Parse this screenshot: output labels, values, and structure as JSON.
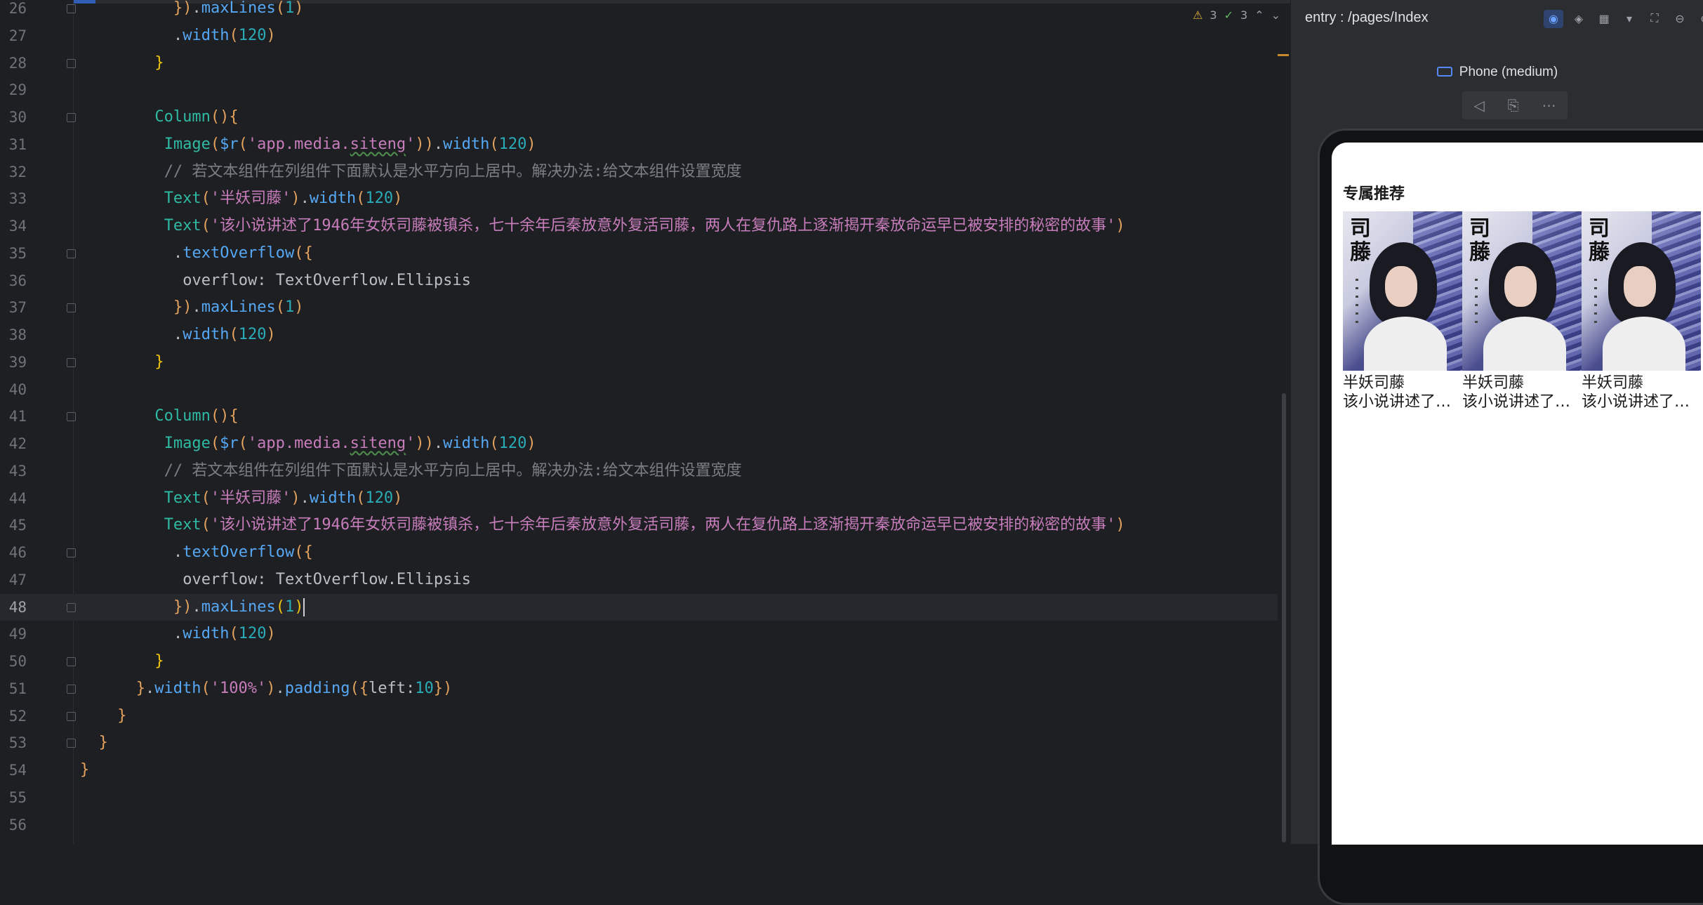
{
  "editor": {
    "inspections": {
      "warnings": "3",
      "weak_warnings": "3"
    },
    "current_line": "48",
    "lines": [
      {
        "n": "26",
        "segs": [
          [
            "k-br2",
            "})"
          ],
          [
            "k-prop",
            "."
          ],
          [
            "k-fn",
            "maxLines"
          ],
          [
            "k-br2",
            "("
          ],
          [
            "k-num",
            "1"
          ],
          [
            "k-br2",
            ")"
          ]
        ]
      },
      {
        "n": "27",
        "segs": [
          [
            "k-prop",
            "."
          ],
          [
            "k-fn",
            "width"
          ],
          [
            "k-br2",
            "("
          ],
          [
            "k-num",
            "120"
          ],
          [
            "k-br2",
            ")"
          ]
        ]
      },
      {
        "n": "28",
        "segs": [
          [
            "k-br",
            "}"
          ]
        ]
      },
      {
        "n": "29",
        "segs": []
      },
      {
        "n": "30",
        "segs": [
          [
            "k-cmp",
            "Column"
          ],
          [
            "k-br2",
            "(){"
          ]
        ]
      },
      {
        "n": "31",
        "segs": [
          [
            "k-cmp",
            "Image"
          ],
          [
            "k-br2",
            "("
          ],
          [
            "k-fn",
            "$r"
          ],
          [
            "k-br2",
            "("
          ],
          [
            "k-str",
            "'app.media."
          ],
          [
            "k-str k-err",
            "siteng"
          ],
          [
            "k-str",
            "'"
          ],
          [
            "k-br2",
            "))"
          ],
          [
            "k-prop",
            "."
          ],
          [
            "k-fn",
            "width"
          ],
          [
            "k-br2",
            "("
          ],
          [
            "k-num",
            "120"
          ],
          [
            "k-br2",
            ")"
          ]
        ]
      },
      {
        "n": "32",
        "segs": [
          [
            "k-cm",
            "// 若文本组件在列组件下面默认是水平方向上居中。解决办法:给文本组件设置宽度"
          ]
        ]
      },
      {
        "n": "33",
        "segs": [
          [
            "k-cmp",
            "Text"
          ],
          [
            "k-br2",
            "("
          ],
          [
            "k-str",
            "'半妖司藤'"
          ],
          [
            "k-br2",
            ")"
          ],
          [
            "k-prop",
            "."
          ],
          [
            "k-fn",
            "width"
          ],
          [
            "k-br2",
            "("
          ],
          [
            "k-num",
            "120"
          ],
          [
            "k-br2",
            ")"
          ]
        ]
      },
      {
        "n": "34",
        "segs": [
          [
            "k-cmp",
            "Text"
          ],
          [
            "k-br2",
            "("
          ],
          [
            "k-str",
            "'该小说讲述了1946年女妖司藤被镇杀，七十余年后秦放意外复活司藤，两人在复仇路上逐渐揭开秦放命运早已被安排的秘密的故事'"
          ],
          [
            "k-br2",
            ")"
          ]
        ]
      },
      {
        "n": "35",
        "segs": [
          [
            "k-prop",
            "."
          ],
          [
            "k-fn",
            "textOverflow"
          ],
          [
            "k-br2",
            "({"
          ]
        ]
      },
      {
        "n": "36",
        "segs": [
          [
            "k-prop",
            "overflow: TextOverflow.Ellipsis"
          ]
        ]
      },
      {
        "n": "37",
        "segs": [
          [
            "k-br2",
            "})"
          ],
          [
            "k-prop",
            "."
          ],
          [
            "k-fn",
            "maxLines"
          ],
          [
            "k-br2",
            "("
          ],
          [
            "k-num",
            "1"
          ],
          [
            "k-br2",
            ")"
          ]
        ]
      },
      {
        "n": "38",
        "segs": [
          [
            "k-prop",
            "."
          ],
          [
            "k-fn",
            "width"
          ],
          [
            "k-br2",
            "("
          ],
          [
            "k-num",
            "120"
          ],
          [
            "k-br2",
            ")"
          ]
        ]
      },
      {
        "n": "39",
        "segs": [
          [
            "k-br",
            "}"
          ]
        ]
      },
      {
        "n": "40",
        "segs": []
      },
      {
        "n": "41",
        "segs": [
          [
            "k-cmp",
            "Column"
          ],
          [
            "k-br2",
            "(){"
          ]
        ]
      },
      {
        "n": "42",
        "segs": [
          [
            "k-cmp",
            "Image"
          ],
          [
            "k-br2",
            "("
          ],
          [
            "k-fn",
            "$r"
          ],
          [
            "k-br2",
            "("
          ],
          [
            "k-str",
            "'app.media."
          ],
          [
            "k-str k-err",
            "siteng"
          ],
          [
            "k-str",
            "'"
          ],
          [
            "k-br2",
            "))"
          ],
          [
            "k-prop",
            "."
          ],
          [
            "k-fn",
            "width"
          ],
          [
            "k-br2",
            "("
          ],
          [
            "k-num",
            "120"
          ],
          [
            "k-br2",
            ")"
          ]
        ]
      },
      {
        "n": "43",
        "segs": [
          [
            "k-cm",
            "// 若文本组件在列组件下面默认是水平方向上居中。解决办法:给文本组件设置宽度"
          ]
        ]
      },
      {
        "n": "44",
        "segs": [
          [
            "k-cmp",
            "Text"
          ],
          [
            "k-br2",
            "("
          ],
          [
            "k-str",
            "'半妖司藤'"
          ],
          [
            "k-br2",
            ")"
          ],
          [
            "k-prop",
            "."
          ],
          [
            "k-fn",
            "width"
          ],
          [
            "k-br2",
            "("
          ],
          [
            "k-num",
            "120"
          ],
          [
            "k-br2",
            ")"
          ]
        ]
      },
      {
        "n": "45",
        "segs": [
          [
            "k-cmp",
            "Text"
          ],
          [
            "k-br2",
            "("
          ],
          [
            "k-str",
            "'该小说讲述了1946年女妖司藤被镇杀，七十余年后秦放意外复活司藤，两人在复仇路上逐渐揭开秦放命运早已被安排的秘密的故事'"
          ],
          [
            "k-br2",
            ")"
          ]
        ]
      },
      {
        "n": "46",
        "segs": [
          [
            "k-prop",
            "."
          ],
          [
            "k-fn",
            "textOverflow"
          ],
          [
            "k-br2",
            "({"
          ]
        ]
      },
      {
        "n": "47",
        "segs": [
          [
            "k-prop",
            "overflow: TextOverflow.Ellipsis"
          ]
        ]
      },
      {
        "n": "48",
        "segs": [
          [
            "k-br2",
            "})"
          ],
          [
            "k-prop",
            "."
          ],
          [
            "k-fn",
            "maxLines"
          ],
          [
            "k-br",
            "("
          ],
          [
            "k-num",
            "1"
          ],
          [
            "k-br",
            ")"
          ]
        ]
      },
      {
        "n": "49",
        "segs": [
          [
            "k-prop",
            "."
          ],
          [
            "k-fn",
            "width"
          ],
          [
            "k-br2",
            "("
          ],
          [
            "k-num",
            "120"
          ],
          [
            "k-br2",
            ")"
          ]
        ]
      },
      {
        "n": "50",
        "segs": [
          [
            "k-br",
            "}"
          ]
        ]
      },
      {
        "n": "51",
        "segs": [
          [
            "k-br2",
            "}"
          ],
          [
            "k-prop",
            "."
          ],
          [
            "k-fn",
            "width"
          ],
          [
            "k-br2",
            "("
          ],
          [
            "k-str",
            "'100%'"
          ],
          [
            "k-br2",
            ")"
          ],
          [
            "k-prop",
            "."
          ],
          [
            "k-fn",
            "padding"
          ],
          [
            "k-br2",
            "({"
          ],
          [
            "k-prop",
            "left:"
          ],
          [
            "k-num",
            "10"
          ],
          [
            "k-br2",
            "})"
          ]
        ]
      },
      {
        "n": "52",
        "segs": [
          [
            "k-br2",
            "}"
          ]
        ]
      },
      {
        "n": "53",
        "segs": [
          [
            "k-br2",
            "}"
          ]
        ]
      },
      {
        "n": "54",
        "segs": [
          [
            "k-br2",
            "}"
          ]
        ]
      },
      {
        "n": "55",
        "segs": []
      },
      {
        "n": "56",
        "segs": []
      }
    ],
    "indent": [
      10,
      10,
      8,
      0,
      8,
      9,
      9,
      9,
      9,
      10,
      11,
      10,
      10,
      8,
      0,
      8,
      9,
      9,
      9,
      9,
      10,
      11,
      10,
      10,
      8,
      6,
      4,
      2,
      0,
      0,
      0
    ]
  },
  "preview": {
    "path": "entry : /pages/Index",
    "device": "Phone (medium)",
    "app": {
      "title": "专属推荐",
      "cards": [
        {
          "title": "半妖司藤",
          "desc": "该小说讲述了…",
          "cover_glyph": "司藤"
        },
        {
          "title": "半妖司藤",
          "desc": "该小说讲述了…",
          "cover_glyph": "司藤"
        },
        {
          "title": "半妖司藤",
          "desc": "该小说讲述了…",
          "cover_glyph": "司藤"
        }
      ]
    }
  },
  "icons": {
    "warning": "warning-icon",
    "weak_warning": "weak-warning-icon",
    "prev": "chevron-up-icon",
    "next": "chevron-down-icon",
    "device": "device-icon",
    "back": "back-triangle-icon",
    "rotate": "rotate-icon",
    "more": "more-dots-icon"
  },
  "colors": {
    "editor_bg": "#1e1f22",
    "panel_bg": "#2b2d30",
    "accent": "#3574f0"
  }
}
